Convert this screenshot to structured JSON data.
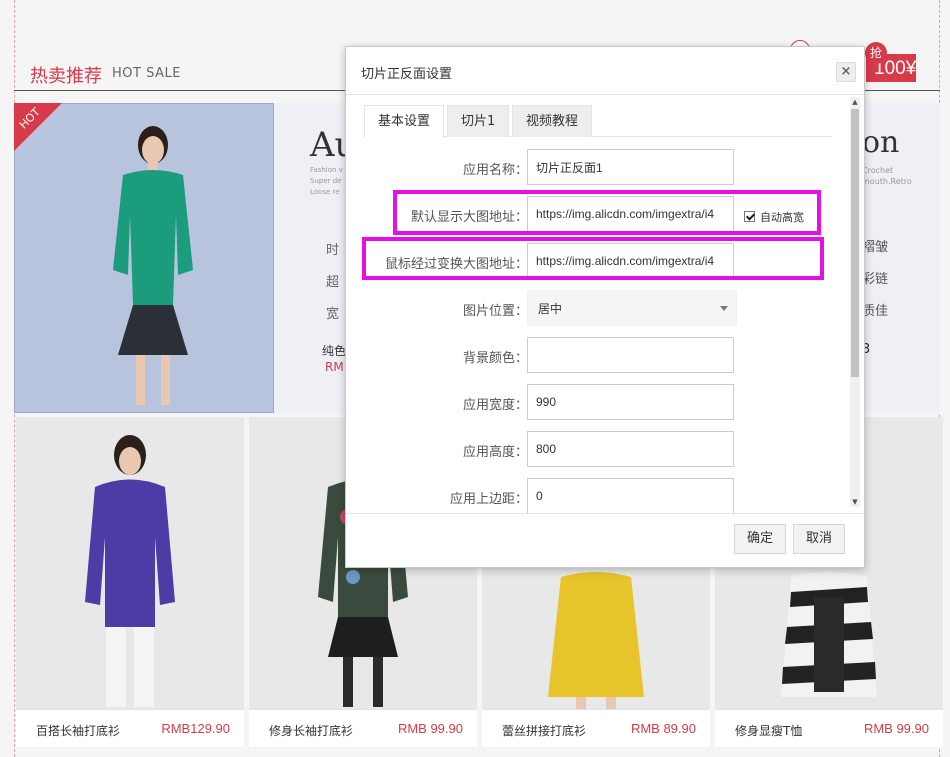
{
  "background": {
    "hot_title": "热卖推荐",
    "hot_subtitle": "HOT SALE",
    "grab_label": "抢",
    "grab_amount": "100¥",
    "hot_ribbon": "HOT",
    "banner_left_letters": "Au",
    "banner_left_small": [
      "Fashion v",
      "Super de",
      "Loose re"
    ],
    "banner_right_letters": "on",
    "banner_right_small": [
      "Crochet",
      "mouth.Retro"
    ],
    "banner_left_lines": [
      "时",
      "超",
      "宽"
    ],
    "banner_right_lines": [
      "褶皱",
      "彩链",
      "质佳"
    ],
    "banner_left_tag": "纯色",
    "banner_left_tag2": "RM",
    "banner_right_mark": "3",
    "products": [
      {
        "name": "百搭长袖打底衫",
        "price": "RMB129.90"
      },
      {
        "name": "修身长袖打底衫",
        "price": "RMB 99.90"
      },
      {
        "name": "蕾丝拼接打底衫",
        "price": "RMB  89.90"
      },
      {
        "name": "修身显瘦T恤",
        "price": "RMB 99.90"
      }
    ]
  },
  "dialog": {
    "title": "切片正反面设置",
    "close_glyph": "×",
    "tabs": [
      {
        "label": "基本设置",
        "active": true
      },
      {
        "label": "切片1",
        "active": false
      },
      {
        "label": "视频教程",
        "active": false
      }
    ],
    "fields": {
      "app_name": {
        "label": "应用名称：",
        "value": "切片正反面1"
      },
      "default_image": {
        "label": "默认显示大图地址：",
        "value": "https://img.alicdn.com/imgextra/i4"
      },
      "auto_height": {
        "label": "自动高宽",
        "checked": true
      },
      "hover_image": {
        "label": "鼠标经过变换大图地址：",
        "value": "https://img.alicdn.com/imgextra/i4"
      },
      "image_position": {
        "label": "图片位置：",
        "value": "居中"
      },
      "bg_color": {
        "label": "背景颜色：",
        "value": ""
      },
      "app_width": {
        "label": "应用宽度：",
        "value": "990"
      },
      "app_height": {
        "label": "应用高度：",
        "value": "800"
      },
      "app_top_margin": {
        "label": "应用上边距：",
        "value": "0"
      }
    },
    "buttons": {
      "confirm": "确定",
      "cancel": "取消"
    }
  },
  "colors": {
    "accent_red": "#d93a49",
    "highlight_magenta": "#e510e5"
  }
}
